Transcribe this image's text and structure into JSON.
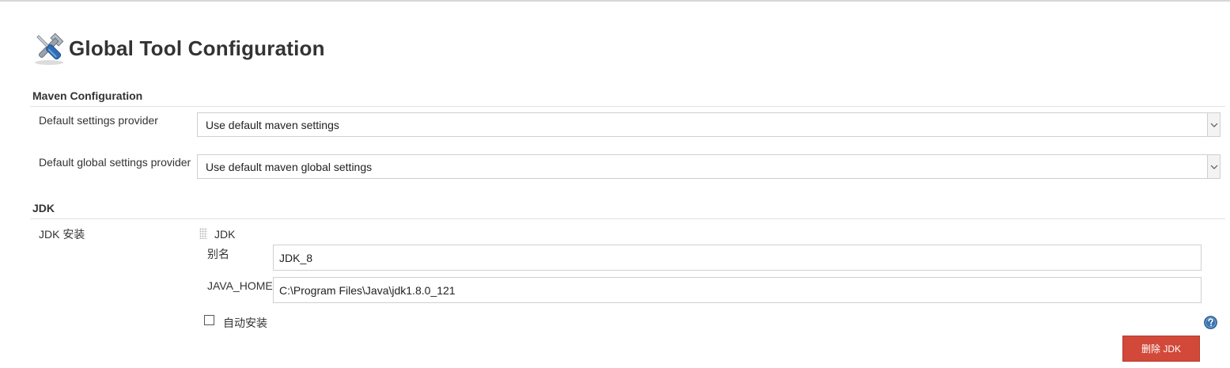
{
  "page": {
    "title": "Global Tool Configuration",
    "icon": "tools-wrench-screwdriver-icon"
  },
  "maven": {
    "section_title": "Maven Configuration",
    "settings_provider": {
      "label": "Default settings provider",
      "selected": "Use default maven settings"
    },
    "global_settings_provider": {
      "label": "Default global settings provider",
      "selected": "Use default maven global settings"
    }
  },
  "jdk": {
    "section_title": "JDK",
    "installations_label": "JDK 安装",
    "block_title": "JDK",
    "alias_label": "别名",
    "alias_value": "JDK_8",
    "java_home_label": "JAVA_HOME",
    "java_home_value": "C:\\Program Files\\Java\\jdk1.8.0_121",
    "auto_install_label": "自动安装",
    "auto_install_checked": false,
    "delete_button_label": "删除 JDK"
  },
  "colors": {
    "delete_button": "#d24939",
    "help_icon": "#3874ae",
    "rule": "#e2e2e2"
  }
}
